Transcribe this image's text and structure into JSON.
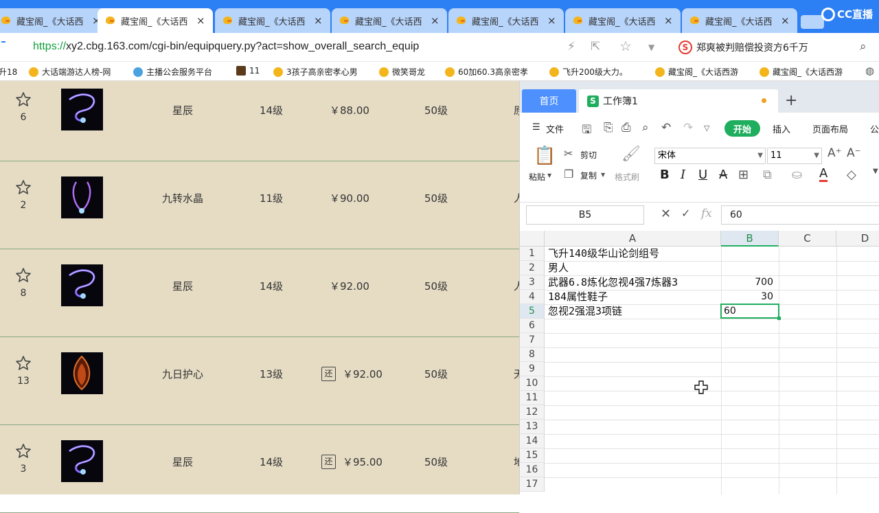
{
  "browser": {
    "tabs": [
      {
        "label": "藏宝阁_《大话西"
      },
      {
        "label": "藏宝阁_《大话西"
      },
      {
        "label": "藏宝阁_《大话西"
      },
      {
        "label": "藏宝阁_《大话西"
      },
      {
        "label": "藏宝阁_《大话西"
      },
      {
        "label": "藏宝阁_《大话西"
      },
      {
        "label": "藏宝阁_《大话西"
      }
    ],
    "close_glyph": "×",
    "brand": "CC直播",
    "url_protocol": "https://",
    "url_rest": "xy2.cbg.163.com/cgi-bin/equipquery.py?act=show_overall_search_equip",
    "search_hint": "郑爽被判赔偿投资方6千万",
    "search_badge": "S",
    "bookmarks": [
      "升18",
      "大话端游达人榜-网",
      "主播公会服务平台",
      "11",
      "3孩子高亲密孝心男",
      "微笑哥龙",
      "60加60.3高亲密孝",
      "飞升200级大力。",
      "藏宝阁_《大话西游",
      "藏宝阁_《大话西游"
    ]
  },
  "listing": {
    "rows": [
      {
        "count": "6",
        "name": "星辰",
        "level": "14级",
        "price": "￥88.00",
        "returnable": false,
        "req": "50级",
        "extra": "原"
      },
      {
        "count": "2",
        "name": "九转水晶",
        "level": "11级",
        "price": "￥90.00",
        "returnable": false,
        "req": "50级",
        "extra": "人"
      },
      {
        "count": "8",
        "name": "星辰",
        "level": "14级",
        "price": "￥92.00",
        "returnable": false,
        "req": "50级",
        "extra": "人"
      },
      {
        "count": "13",
        "name": "九日护心",
        "level": "13级",
        "price": "￥92.00",
        "returnable": true,
        "req": "50级",
        "extra": "无"
      },
      {
        "count": "3",
        "name": "星辰",
        "level": "14级",
        "price": "￥95.00",
        "returnable": true,
        "req": "50级",
        "extra": "地"
      }
    ],
    "return_tag": "还"
  },
  "spreadsheet": {
    "home_tab": "首页",
    "workbook_tab": "工作簿1",
    "workbook_icon": "S",
    "add_tab": "+",
    "menu": {
      "file": "文件",
      "start": "开始",
      "insert": "插入",
      "page_layout": "页面布局",
      "formula": "公"
    },
    "ribbon": {
      "paste": "粘贴",
      "cut": "剪切",
      "copy": "复制",
      "format_painter": "格式刷",
      "font_name": "宋体",
      "font_size": "11"
    },
    "name_box": "B5",
    "formula_value": "60",
    "fx": "fx",
    "columns": [
      "A",
      "B",
      "C",
      "D"
    ],
    "row_numbers": [
      "1",
      "2",
      "3",
      "4",
      "5",
      "6",
      "7",
      "8",
      "9",
      "10",
      "11",
      "12",
      "13",
      "14",
      "15",
      "16",
      "17"
    ],
    "cells": {
      "A1": "飞升140级华山论剑组号",
      "A2": "男人",
      "A3": "武器6.8炼化忽视4强7炼器3",
      "A4": "184属性鞋子",
      "A5": "忽视2强混3项链",
      "B3": "700",
      "B4": "30",
      "B5": "60"
    }
  },
  "colors": {
    "browser_blue": "#2d7ff4",
    "page_bg": "#e6dcc4",
    "accent_green": "#1fae5e",
    "home_tab_blue": "#4d90fe"
  }
}
